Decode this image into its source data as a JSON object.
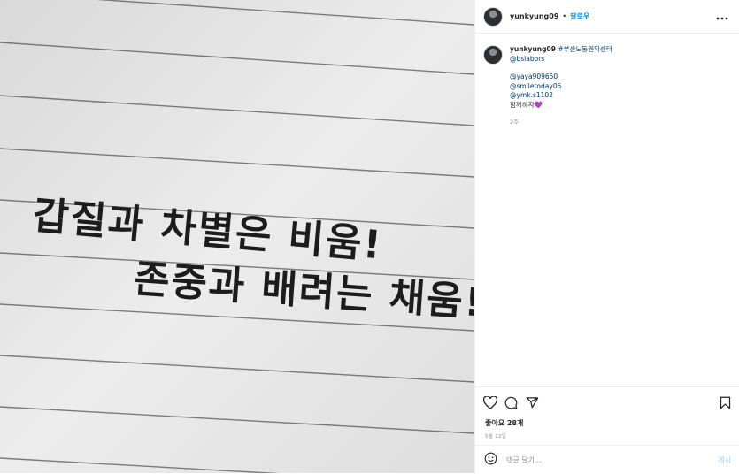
{
  "header": {
    "username": "yunkyung09",
    "separator": "•",
    "follow_label": "팔로우"
  },
  "caption": {
    "username": "yunkyung09",
    "hashtag": "#부산노동권익센터",
    "mentions": [
      "@bslabors",
      "@yaya909650",
      "@smiletoday05",
      "@ymk.s1102"
    ],
    "together_text": "함께하자",
    "emoji": "💜",
    "time_ago": "2주"
  },
  "image": {
    "line1": "갑질과 차별은 비움!",
    "line2": "존중과 배려는 채움!"
  },
  "stats": {
    "likes": "좋아요 28개",
    "date": "5월 12일"
  },
  "comment": {
    "placeholder": "댓글 달기...",
    "post_label": "게시"
  },
  "icons": [
    "heart-icon",
    "comment-icon",
    "share-icon",
    "bookmark-icon",
    "more-icon",
    "smile-icon"
  ]
}
